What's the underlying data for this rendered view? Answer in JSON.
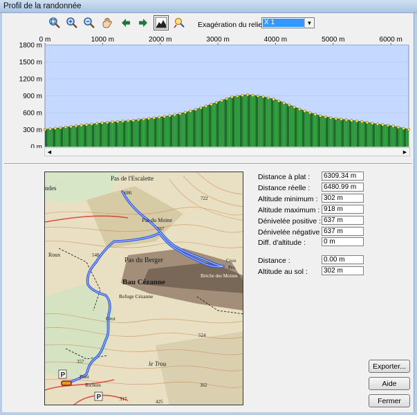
{
  "window": {
    "title": "Profil de la randonnée"
  },
  "toolbar": {
    "tools": [
      {
        "name": "zoom-fit-icon",
        "tooltip": ""
      },
      {
        "name": "zoom-in-icon",
        "tooltip": ""
      },
      {
        "name": "zoom-out-icon",
        "tooltip": ""
      },
      {
        "name": "pan-hand-icon",
        "tooltip": ""
      },
      {
        "name": "arrow-left-icon",
        "tooltip": ""
      },
      {
        "name": "arrow-right-icon",
        "tooltip": ""
      },
      {
        "name": "profile-view-icon",
        "tooltip": ""
      },
      {
        "name": "measure-icon",
        "tooltip": ""
      }
    ],
    "relief_label": "Exagération du relief :",
    "relief_value": "X 1"
  },
  "chart_data": {
    "type": "area",
    "x_ticks": [
      "0 m",
      "1000 m",
      "2000 m",
      "3000 m",
      "4000 m",
      "5000 m",
      "6000 m"
    ],
    "x_tick_values": [
      0,
      1000,
      2000,
      3000,
      4000,
      5000,
      6000
    ],
    "y_ticks": [
      "1800 m",
      "1500 m",
      "1200 m",
      "900 m",
      "600 m",
      "300 m",
      "0 m"
    ],
    "y_tick_values": [
      1800,
      1500,
      1200,
      900,
      600,
      300,
      0
    ],
    "xlim": [
      0,
      6309.34
    ],
    "ylim": [
      0,
      1800
    ],
    "x": [
      0,
      250,
      500,
      750,
      1000,
      1250,
      1500,
      1750,
      2000,
      2250,
      2500,
      2750,
      3000,
      3250,
      3500,
      3750,
      4000,
      4250,
      4500,
      4750,
      5000,
      5250,
      5500,
      5750,
      6000,
      6309
    ],
    "y": [
      302,
      330,
      360,
      390,
      420,
      440,
      460,
      490,
      520,
      560,
      620,
      700,
      790,
      880,
      918,
      890,
      830,
      730,
      630,
      550,
      500,
      470,
      440,
      400,
      370,
      302
    ],
    "fill_color": "#2e9a3b",
    "line_color": "#1a4a1a",
    "marker_color": "#f2e25a",
    "background_color": "#c5d8ff",
    "grid": true
  },
  "stats": [
    {
      "label": "Distance à plat :",
      "value": "6309.34 m"
    },
    {
      "label": "Distance réelle :",
      "value": "6480.99 m"
    },
    {
      "label": "Altitude minimum :",
      "value": "302 m"
    },
    {
      "label": "Altitude maximum :",
      "value": "918 m"
    },
    {
      "label": "Dénivelée positive :",
      "value": "637 m"
    },
    {
      "label": "Dénivelée négative :",
      "value": "637 m"
    },
    {
      "label": "Diff. d'altitude :",
      "value": "0 m"
    },
    {
      "label": "Distance :",
      "value": "0.00 m"
    },
    {
      "label": "Altitude au sol :",
      "value": "302 m"
    }
  ],
  "map": {
    "place_names": [
      "Pas de l'Escalette",
      "Pas du Moine",
      "Pas du Berger",
      "Bau Cézanne",
      "Refuge Cézanne",
      "Brèche des Moines",
      "le Trou",
      "Roux",
      "Orot",
      "Pont",
      "Richois",
      "ndes",
      "Crou",
      "Pro"
    ],
    "elevations": [
      "686",
      "722",
      "767",
      "548",
      "524",
      "357",
      "362",
      "317",
      "425"
    ]
  },
  "buttons": {
    "export": "Exporter...",
    "help": "Aide",
    "close": "Fermer"
  }
}
